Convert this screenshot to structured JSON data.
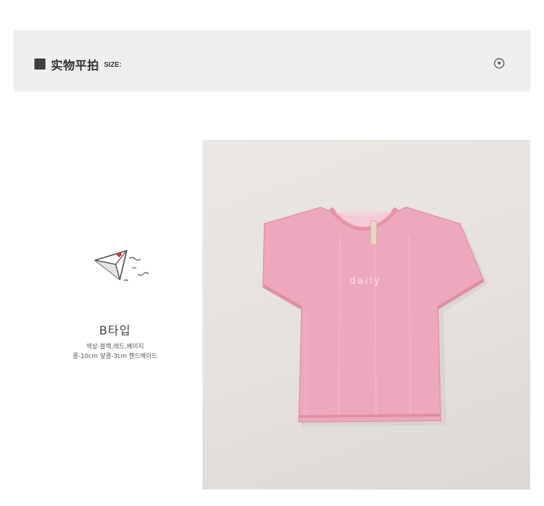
{
  "section": {
    "title": "实物平拍",
    "size_label": "SIZE:",
    "toggle_icon": "chevron-down-circle-icon"
  },
  "type_block": {
    "title": "B타입",
    "line1": "색상-블랙,레드,베이지",
    "line2": "콤-10cm 앞콤-3cm 핸드메이드",
    "icon": "paper-plane-icon"
  },
  "photo": {
    "subject": "pink t-shirt",
    "shirt_text": "daily"
  },
  "colors": {
    "bar_bg": "#efefef",
    "shirt": "#eea8bd",
    "heart": "#e03131"
  }
}
